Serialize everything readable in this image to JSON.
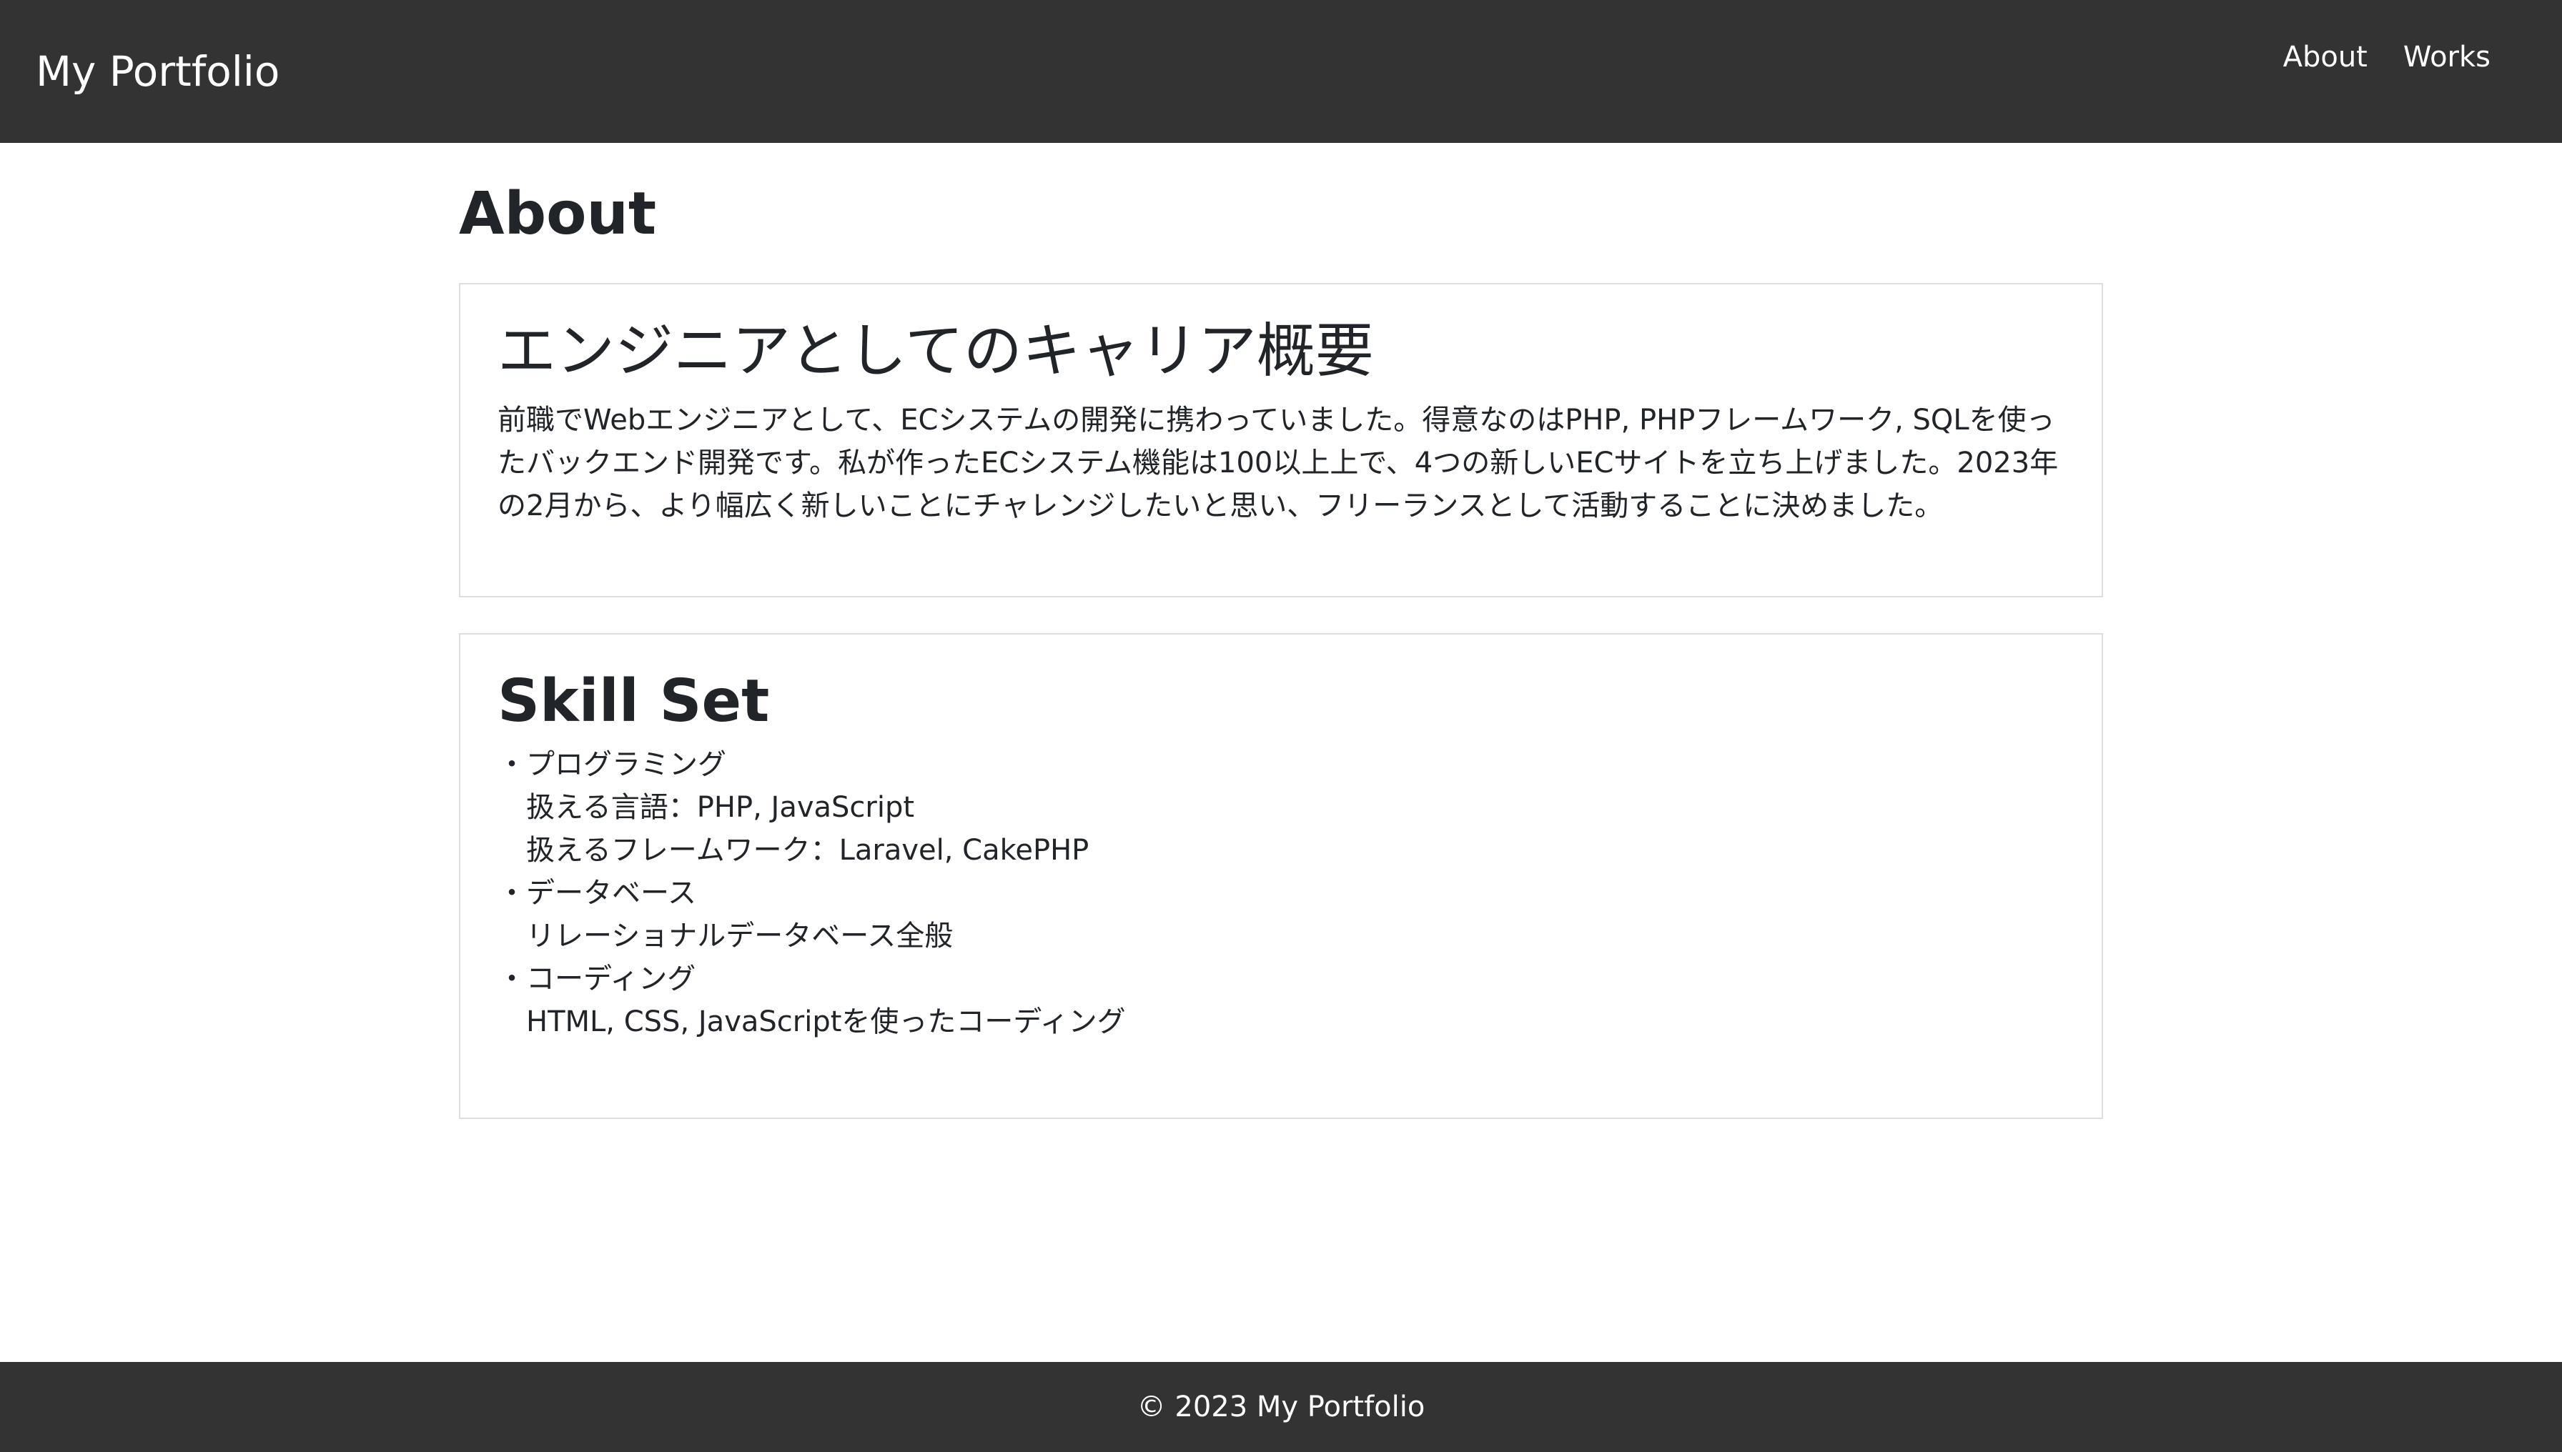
{
  "header": {
    "brand": "My Portfolio",
    "nav": [
      {
        "label": "About"
      },
      {
        "label": "Works"
      }
    ]
  },
  "main": {
    "page_title": "About",
    "career": {
      "heading": "エンジニアとしてのキャリア概要",
      "body": "前職でWebエンジニアとして、ECシステムの開発に携わっていました。得意なのはPHP, PHPフレームワーク, SQLを使ったバックエンド開発です。私が作ったECシステム機能は100以上上で、4つの新しいECサイトを立ち上げました。2023年の2月から、より幅広く新しいことにチャレンジしたいと思い、フリーランスとして活動することに決めました。"
    },
    "skills": {
      "heading": "Skill Set",
      "items": [
        {
          "title": "・プログラミング",
          "details": [
            "扱える言語：PHP, JavaScript",
            "扱えるフレームワーク：Laravel, CakePHP"
          ]
        },
        {
          "title": "・データベース",
          "details": [
            "リレーショナルデータベース全般"
          ]
        },
        {
          "title": "・コーディング",
          "details": [
            "HTML, CSS, JavaScriptを使ったコーディング"
          ]
        }
      ]
    }
  },
  "footer": {
    "copyright": "© 2023 My Portfolio"
  },
  "colors": {
    "navbar": "#333333",
    "nav_text": "#ffffff",
    "text": "#212529",
    "card_border": "#dedede",
    "background": "#ffffff"
  }
}
